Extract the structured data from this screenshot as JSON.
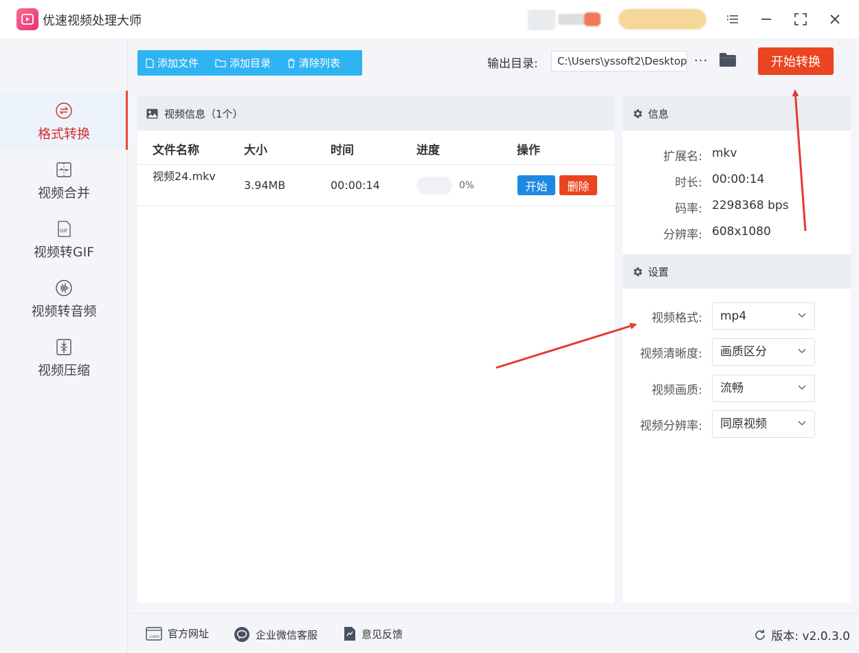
{
  "app": {
    "title": "优速视频处理大师"
  },
  "sidebar": {
    "items": [
      {
        "label": "格式转换",
        "icon": "format-convert-icon",
        "active": true
      },
      {
        "label": "视频合并",
        "icon": "merge-icon"
      },
      {
        "label": "视频转GIF",
        "icon": "gif-icon"
      },
      {
        "label": "视频转音频",
        "icon": "audio-icon"
      },
      {
        "label": "视频压缩",
        "icon": "compress-icon"
      }
    ]
  },
  "toolbar": {
    "add_file": "添加文件",
    "add_dir": "添加目录",
    "clear_list": "清除列表",
    "output_label": "输出目录:",
    "output_path": "C:\\Users\\yssoft2\\Desktop",
    "more": "···",
    "start_convert": "开始转换"
  },
  "video_panel": {
    "title": "视频信息（1个）",
    "columns": [
      "文件名称",
      "大小",
      "时间",
      "进度",
      "操作"
    ],
    "rows": [
      {
        "name": "视频24.mkv",
        "size": "3.94MB",
        "time": "00:00:14",
        "progress": "0%",
        "progress_value": 0,
        "start": "开始",
        "delete": "删除"
      }
    ]
  },
  "info_panel": {
    "title": "信息",
    "fields": [
      {
        "key": "扩展名:",
        "value": "mkv"
      },
      {
        "key": "时长:",
        "value": "00:00:14"
      },
      {
        "key": "码率:",
        "value": "2298368 bps"
      },
      {
        "key": "分辨率:",
        "value": "608x1080"
      }
    ]
  },
  "settings_panel": {
    "title": "设置",
    "fields": [
      {
        "key": "视频格式:",
        "value": "mp4"
      },
      {
        "key": "视频清晰度:",
        "value": "画质区分"
      },
      {
        "key": "视频画质:",
        "value": "流畅"
      },
      {
        "key": "视频分辨率:",
        "value": "同原视频"
      }
    ]
  },
  "footer": {
    "website": "官方网址",
    "wechat": "企业微信客服",
    "feedback": "意见反馈",
    "version": "版本: v2.0.3.0"
  },
  "colors": {
    "accent_red": "#ea4420",
    "accent_blue": "#2fb3f2",
    "button_blue": "#1e88e5",
    "annotation_arrow": "#e53935"
  }
}
